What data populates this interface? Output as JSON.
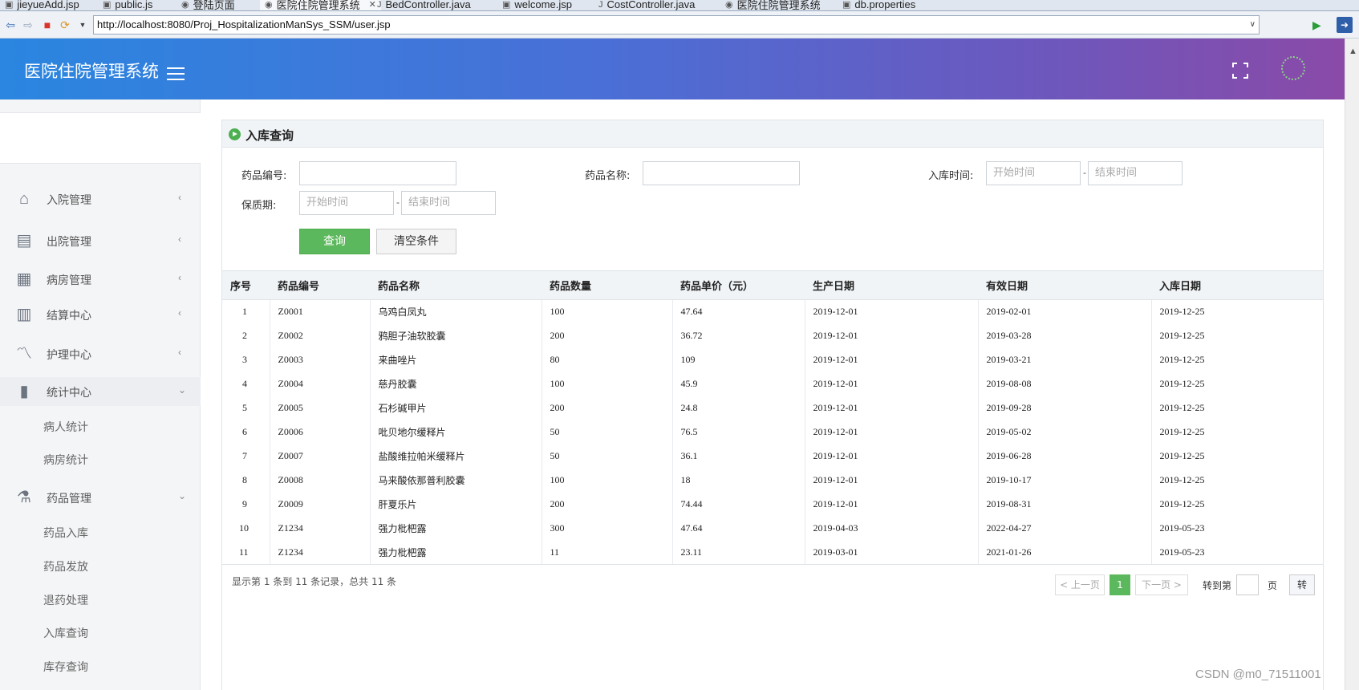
{
  "ide_tabs": [
    {
      "label": "jieyueAdd.jsp"
    },
    {
      "label": "public.js"
    },
    {
      "label": "登陆页面"
    },
    {
      "label": "医院住院管理系统"
    },
    {
      "label": "BedController.java"
    },
    {
      "label": "welcome.jsp"
    },
    {
      "label": "CostController.java"
    },
    {
      "label": "医院住院管理系统"
    },
    {
      "label": "db.properties"
    }
  ],
  "browser": {
    "url": "http://localhost:8080/Proj_HospitalizationManSys_SSM/user.jsp"
  },
  "header": {
    "title": "医院住院管理系统"
  },
  "sidebar": {
    "items": [
      {
        "label": "入院管理",
        "icon": "home-icon"
      },
      {
        "label": "出院管理",
        "icon": "clipboard-icon"
      },
      {
        "label": "病房管理",
        "icon": "building-icon"
      },
      {
        "label": "结算中心",
        "icon": "map-icon"
      },
      {
        "label": "护理中心",
        "icon": "line-chart-icon"
      },
      {
        "label": "统计中心",
        "icon": "bar-chart-icon",
        "sub": [
          "病人统计",
          "病房统计"
        ]
      },
      {
        "label": "药品管理",
        "icon": "flask-icon",
        "sub": [
          "药品入库",
          "药品发放",
          "退药处理",
          "入库查询",
          "库存查询"
        ]
      }
    ]
  },
  "panel": {
    "title": "入库查询"
  },
  "form": {
    "drug_code_label": "药品编号:",
    "drug_name_label": "药品名称:",
    "in_time_label": "入库时间:",
    "shelf_life_label": "保质期:",
    "start_placeholder": "开始时间",
    "end_placeholder": "结束时间",
    "dash": "-",
    "query_label": "查询",
    "clear_label": "清空条件"
  },
  "table": {
    "columns": [
      "序号",
      "药品编号",
      "药品名称",
      "药品数量",
      "药品单价（元）",
      "生产日期",
      "有效日期",
      "入库日期"
    ],
    "rows": [
      [
        "1",
        "Z0001",
        "乌鸡白凤丸",
        "100",
        "47.64",
        "2019-12-01",
        "2019-02-01",
        "2019-12-25"
      ],
      [
        "2",
        "Z0002",
        "鸦胆子油软胶囊",
        "200",
        "36.72",
        "2019-12-01",
        "2019-03-28",
        "2019-12-25"
      ],
      [
        "3",
        "Z0003",
        "来曲唑片",
        "80",
        "109",
        "2019-12-01",
        "2019-03-21",
        "2019-12-25"
      ],
      [
        "4",
        "Z0004",
        "慈丹胶囊",
        "100",
        "45.9",
        "2019-12-01",
        "2019-08-08",
        "2019-12-25"
      ],
      [
        "5",
        "Z0005",
        "石杉碱甲片",
        "200",
        "24.8",
        "2019-12-01",
        "2019-09-28",
        "2019-12-25"
      ],
      [
        "6",
        "Z0006",
        "吡贝地尔缓释片",
        "50",
        "76.5",
        "2019-12-01",
        "2019-05-02",
        "2019-12-25"
      ],
      [
        "7",
        "Z0007",
        "盐酸维拉帕米缓释片",
        "50",
        "36.1",
        "2019-12-01",
        "2019-06-28",
        "2019-12-25"
      ],
      [
        "8",
        "Z0008",
        "马来酸依那普利胶囊",
        "100",
        "18",
        "2019-12-01",
        "2019-10-17",
        "2019-12-25"
      ],
      [
        "9",
        "Z0009",
        "肝夏乐片",
        "200",
        "74.44",
        "2019-12-01",
        "2019-08-31",
        "2019-12-25"
      ],
      [
        "10",
        "Z1234",
        "强力枇杷露",
        "300",
        "47.64",
        "2019-04-03",
        "2022-04-27",
        "2019-05-23"
      ],
      [
        "11",
        "Z1234",
        "强力枇杷露",
        "11",
        "23.11",
        "2019-03-01",
        "2021-01-26",
        "2019-05-23"
      ]
    ]
  },
  "pagination": {
    "summary": "显示第 1 条到 11 条记录，总共 11 条",
    "prev": "< 上一页",
    "current": "1",
    "next": "下一页 >",
    "goto_prefix": "转到第",
    "goto_suffix": "页",
    "goto_btn": "转"
  },
  "watermark": "CSDN @m0_71511001",
  "colors": {
    "header_gradient_start": "#2a86e0",
    "header_gradient_end": "#8a4aa8",
    "accent_green": "#5cb85c"
  }
}
